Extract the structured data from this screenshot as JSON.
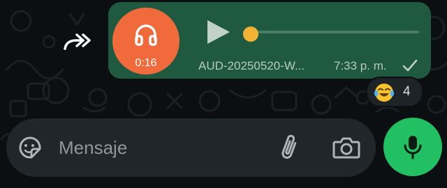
{
  "chat": {
    "voice_message": {
      "duration": "0:16",
      "file_name": "AUD-20250520-W...",
      "time": "7:33 p. m.",
      "playback_progress": 0.0
    },
    "reaction": {
      "emoji": "face-with-tears-of-joy",
      "count": "4"
    }
  },
  "composer": {
    "placeholder": "Mensaje"
  },
  "icons": {
    "forward": "forward-icon",
    "headphones": "headphones-icon",
    "play": "play-icon",
    "read_check": "check-icon",
    "sticker": "sticker-icon",
    "attach": "paperclip-icon",
    "camera": "camera-icon",
    "mic": "microphone-icon"
  },
  "colors": {
    "background": "#0b0f12",
    "bubble": "#1f5a40",
    "avatar": "#f06a3c",
    "seek_thumb": "#f2b233",
    "composer": "#20262a",
    "mic_button": "#21c063"
  }
}
